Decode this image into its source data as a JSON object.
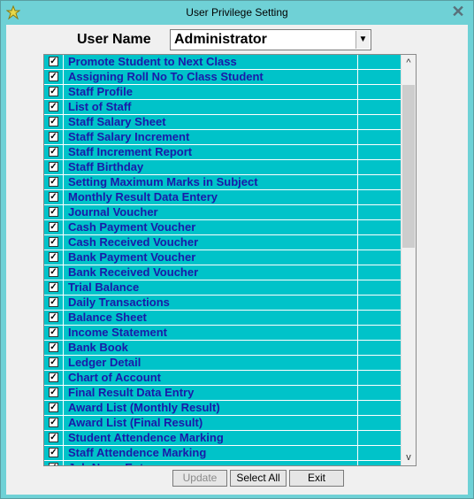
{
  "window": {
    "title": "User Privilege Setting"
  },
  "user": {
    "label": "User Name",
    "value": "Administrator"
  },
  "privileges": [
    {
      "label": "Promote Student to Next Class",
      "checked": true
    },
    {
      "label": "Assigning Roll No To Class Student",
      "checked": true
    },
    {
      "label": "Staff Profile",
      "checked": true
    },
    {
      "label": "List of Staff",
      "checked": true
    },
    {
      "label": "Staff Salary Sheet",
      "checked": true
    },
    {
      "label": "Staff Salary Increment",
      "checked": true
    },
    {
      "label": "Staff Increment Report",
      "checked": true
    },
    {
      "label": "Staff Birthday",
      "checked": true
    },
    {
      "label": "Setting Maximum Marks in Subject",
      "checked": true
    },
    {
      "label": "Monthly Result Data Entery",
      "checked": true
    },
    {
      "label": "Journal Voucher",
      "checked": true
    },
    {
      "label": "Cash Payment Voucher",
      "checked": true
    },
    {
      "label": "Cash Received Voucher",
      "checked": true
    },
    {
      "label": "Bank Payment Voucher",
      "checked": true
    },
    {
      "label": "Bank Received Voucher",
      "checked": true
    },
    {
      "label": "Trial Balance",
      "checked": true
    },
    {
      "label": "Daily Transactions",
      "checked": true
    },
    {
      "label": "Balance Sheet",
      "checked": true
    },
    {
      "label": "Income Statement",
      "checked": true
    },
    {
      "label": "Bank Book",
      "checked": true
    },
    {
      "label": "Ledger Detail",
      "checked": true
    },
    {
      "label": "Chart of Account",
      "checked": true
    },
    {
      "label": "Final Result Data Entry",
      "checked": true
    },
    {
      "label": "Award List (Monthly Result)",
      "checked": true
    },
    {
      "label": "Award List (Final Result)",
      "checked": true
    },
    {
      "label": "Student Attendence Marking",
      "checked": true
    },
    {
      "label": "Staff Attendence Marking",
      "checked": true
    },
    {
      "label": "Job News Entry",
      "checked": true
    }
  ],
  "buttons": {
    "update": "Update",
    "select_all": "Select All",
    "exit": "Exit"
  },
  "colors": {
    "grid_bg": "#00c3c9",
    "frame": "#6fd1d6",
    "item_text": "#1a1aa8"
  }
}
